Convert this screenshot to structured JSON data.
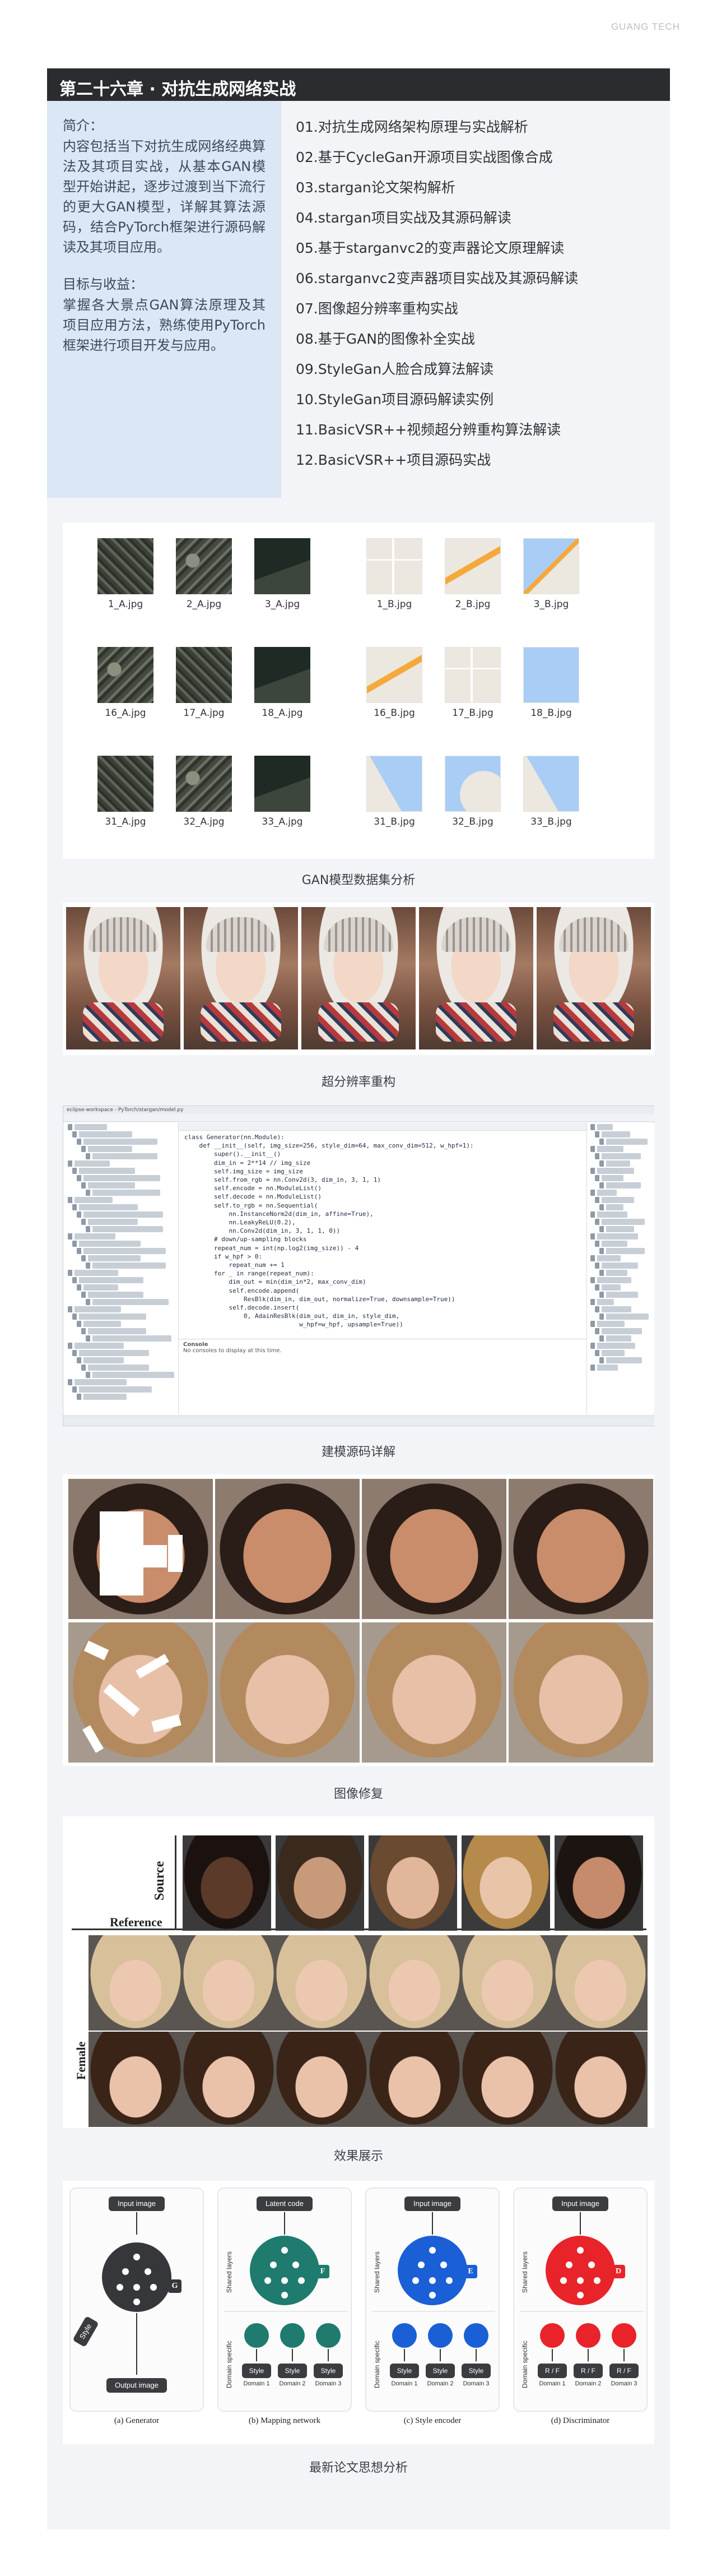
{
  "brand": "GUANG TECH",
  "chapter": {
    "title": "第二十六章 · 对抗生成网络实战"
  },
  "intro": {
    "summary_head": "简介：",
    "summary_text": "内容包括当下对抗生成网络经典算法及其项目实战，从基本GAN模型开始讲起，逐步过渡到当下流行的更大GAN模型，详解其算法源码，结合PyTorch框架进行源码解读及其项目应用。",
    "goal_head": "目标与收益：",
    "goal_text": "掌握各大景点GAN算法原理及其项目应用方法，熟练使用PyTorch框架进行项目开发与应用。"
  },
  "toc": [
    "01.对抗生成网络架构原理与实战解析",
    "02.基于CycleGan开源项目实战图像合成",
    "03.stargan论文架构解析",
    "04.stargan项目实战及其源码解读",
    "05.基于starganvc2的变声器论文原理解读",
    "06.starganvc2变声器项目实战及其源码解读",
    "07.图像超分辨率重构实战",
    "08.基于GAN的图像补全实战",
    "09.StyleGan人脸合成算法解读",
    "10.StyleGan项目源码解读实例",
    "11.BasicVSR++视频超分辨重构算法解读",
    "12.BasicVSR++项目源码实战"
  ],
  "dataset": {
    "caption": "GAN模型数据集分析",
    "labels": [
      [
        "1_A.jpg",
        "2_A.jpg",
        "3_A.jpg",
        "1_B.jpg",
        "2_B.jpg",
        "3_B.jpg"
      ],
      [
        "16_A.jpg",
        "17_A.jpg",
        "18_A.jpg",
        "16_B.jpg",
        "17_B.jpg",
        "18_B.jpg"
      ],
      [
        "31_A.jpg",
        "32_A.jpg",
        "33_A.jpg",
        "31_B.jpg",
        "32_B.jpg",
        "33_B.jpg"
      ]
    ]
  },
  "superres": {
    "caption": "超分辨率重构"
  },
  "source": {
    "caption": "建模源码详解",
    "window_title": "eclipse-workspace - PyTorch/stargan/model.py",
    "console_label": "Console",
    "console_text": "No consoles to display at this time.",
    "code": [
      "",
      "class Generator(nn.Module):",
      "    def __init__(self, img_size=256, style_dim=64, max_conv_dim=512, w_hpf=1):",
      "        super().__init__()",
      "        dim_in = 2**14 // img_size",
      "        self.img_size = img_size",
      "        self.from_rgb = nn.Conv2d(3, dim_in, 3, 1, 1)",
      "        self.encode = nn.ModuleList()",
      "        self.decode = nn.ModuleList()",
      "        self.to_rgb = nn.Sequential(",
      "            nn.InstanceNorm2d(dim_in, affine=True),",
      "            nn.LeakyReLU(0.2),",
      "            nn.Conv2d(dim_in, 3, 1, 1, 0))",
      "",
      "        # down/up-sampling blocks",
      "        repeat_num = int(np.log2(img_size)) - 4",
      "        if w_hpf > 0:",
      "            repeat_num += 1",
      "        for _ in range(repeat_num):",
      "            dim_out = min(dim_in*2, max_conv_dim)",
      "            self.encode.append(",
      "                ResBlk(dim_in, dim_out, normalize=True, downsample=True))",
      "            self.decode.insert(",
      "                0, AdainResBlk(dim_out, dim_in, style_dim,",
      "                               w_hpf=w_hpf, upsample=True))",
      ""
    ]
  },
  "restore": {
    "caption": "图像修复"
  },
  "effect": {
    "caption": "效果展示",
    "source_label": "Source",
    "reference_label": "Reference",
    "female_label": "Female"
  },
  "paper": {
    "caption": "最新论文思想分析",
    "input_label": "Input image",
    "latent_label": "Latent code",
    "output_label": "Output image",
    "style_label": "Style",
    "shared_layers": "Shared layers",
    "domain_specific": "Domain specific",
    "real_fake": "R / F",
    "domains": [
      "Domain 1",
      "Domain 2",
      "Domain 3"
    ],
    "panels": [
      "(a) Generator",
      "(b) Mapping network",
      "(c) Style encoder",
      "(d) Discriminator"
    ],
    "letters": [
      "G",
      "F",
      "E",
      "D"
    ],
    "colors": {
      "generator": "#35373b",
      "mapping": "#1e7b6d",
      "encoder": "#1a5fd6",
      "discriminator": "#e8232a"
    }
  }
}
